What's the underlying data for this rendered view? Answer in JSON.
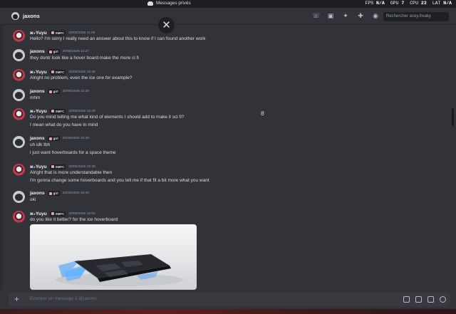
{
  "window": {
    "title": "Messages privés"
  },
  "overlay": {
    "fps_label": "FPS",
    "fps_value": "N/A",
    "gpu_label": "GPU",
    "gpu_value": "7",
    "cpu_label": "CPU",
    "cpu_value": "23",
    "lat_label": "LAT",
    "lat_value": "N/A"
  },
  "header": {
    "channel_name": "jaxons",
    "search_placeholder": "Rechercher acey.freaky"
  },
  "icons": {
    "call": "phone-icon",
    "video": "video-camera-icon",
    "pin": "pin-icon",
    "add_friend": "add-user-icon",
    "profile": "user-profile-icon",
    "close": "close-icon",
    "attach": "plus-icon",
    "gift": "gift-icon",
    "gif": "gif-icon",
    "sticker": "sticker-icon",
    "emoji": "emoji-icon"
  },
  "messages": [
    {
      "author": "ж₊Yuyu",
      "tag": "SMFC",
      "time": "20/05/2026 11:05",
      "lines": [
        "Hello? I'm sorry I really need an answer about this to know if I can found another work"
      ]
    },
    {
      "author": "jaxons",
      "tag": "girl",
      "time": "20/05/2026 10:37",
      "lines": [
        "they dontr look like a hover board make the more ci fi"
      ]
    },
    {
      "author": "ж₊Yuyu",
      "tag": "SMFC",
      "time": "20/05/2026 15:38",
      "lines": [
        "Alright no problem, even the ice one for example?"
      ]
    },
    {
      "author": "jaxons",
      "tag": "girl",
      "time": "20/05/2026 15:38",
      "lines": [
        "mhm"
      ]
    },
    {
      "author": "ж₊Yuyu",
      "tag": "SMFC",
      "time": "20/05/2026 15:39",
      "lines": [
        "Do you mind telling me what kind of elements I should add to make it sci fi?",
        "I mean what do you have in mind"
      ]
    },
    {
      "author": "jaxons",
      "tag": "girl",
      "time": "20/05/2026 15:39",
      "lines": [
        "uh idk tbh",
        "i just want hoverboards for a space theme"
      ]
    },
    {
      "author": "ж₊Yuyu",
      "tag": "SMFC",
      "time": "20/05/2026 15:39",
      "lines": [
        "Alright that is more understandable then",
        "I'm gonna change some hoverboards and you tell me if that fit a bit more what you want"
      ]
    },
    {
      "author": "jaxons",
      "tag": "girl",
      "time": "20/05/2026 15:40",
      "lines": [
        "oki"
      ]
    },
    {
      "author": "ж₊Yuyu",
      "tag": "SMFC",
      "time": "20/05/2026 16:03",
      "lines": [
        "do you like it better? for the ice hoverboard"
      ]
    }
  ],
  "composer": {
    "placeholder": "Envoyer un message à @jaxons"
  },
  "colors": {
    "background": "#313338",
    "sidebar": "#1e1f22",
    "text": "#dbdee1",
    "muted": "#949ba4",
    "ice_blue": "#3a9bff"
  }
}
